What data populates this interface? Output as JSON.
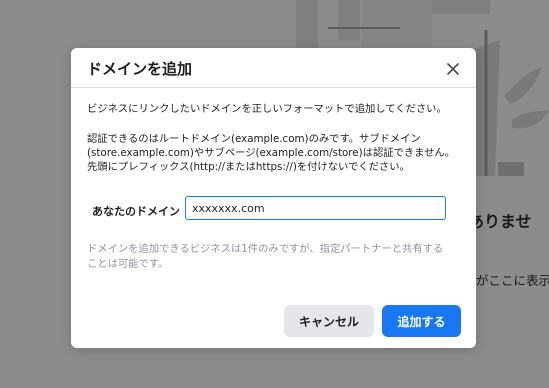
{
  "background": {
    "heading_partial": "ありませ",
    "text_partial": "がここに表示"
  },
  "dialog": {
    "title": "ドメインを追加",
    "close_icon": "close-icon",
    "description_1": "ビジネスにリンクしたいドメインを正しいフォーマットで追加してください。",
    "description_2_lines": [
      "認証できるのはルートドメイン(example.com)のみです。サブドメイン",
      "(store.example.com)やサブページ(example.com/store)は認証できません。",
      "先頭にプレフィックス(http://またはhttps://)を付けないでください。"
    ],
    "field_label": "あなたのドメイン",
    "field_value": "xxxxxxx.com",
    "note_lines": [
      "ドメインを追加できるビジネスは1件のみですが、指定パートナーと共有する",
      "ことは可能です。"
    ],
    "cancel_label": "キャンセル",
    "add_label": "追加する"
  },
  "colors": {
    "primary": "#1877f2",
    "overlay": "#8c8c8c",
    "secondary_button": "#e4e6eb",
    "muted_text": "#8d949e"
  }
}
